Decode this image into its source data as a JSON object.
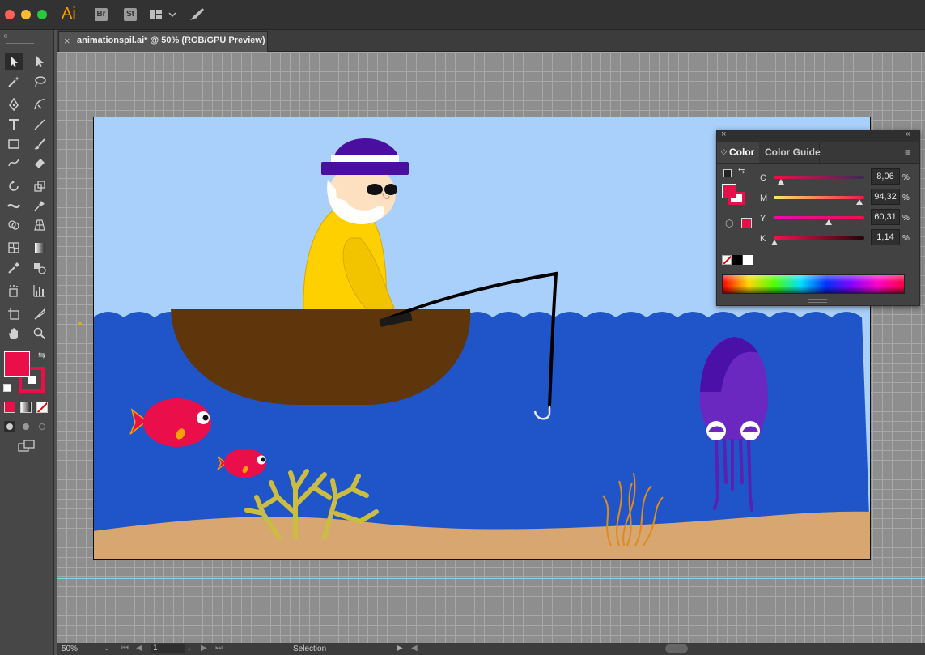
{
  "app": {
    "logo": "Ai",
    "bridge_label": "Br",
    "stock_label": "St"
  },
  "document_tab": {
    "title": "animationspil.ai* @ 50% (RGB/GPU Preview)",
    "close_glyph": "×"
  },
  "color_panel": {
    "tabs": [
      {
        "label": "Color"
      },
      {
        "label": "Color Guide"
      }
    ],
    "channels": [
      {
        "label": "C",
        "value": "8,06",
        "unit": "%",
        "level": 0.0806,
        "gradient": "linear-gradient(90deg,#f20d4a,#3b2a55)"
      },
      {
        "label": "M",
        "value": "94,32",
        "unit": "%",
        "level": 0.9432,
        "gradient": "linear-gradient(90deg,#f8e76b,#f2144f)"
      },
      {
        "label": "Y",
        "value": "60,31",
        "unit": "%",
        "level": 0.6031,
        "gradient": "linear-gradient(90deg,#e60db3,#f20d4a)"
      },
      {
        "label": "K",
        "value": "1,14",
        "unit": "%",
        "level": 0.0114,
        "gradient": "linear-gradient(90deg,#f2144f,#250508)"
      }
    ],
    "fill_color": "#ea0f4a"
  },
  "status_bar": {
    "zoom": "50%",
    "artboard": "1",
    "tool_name": "Selection"
  },
  "colors": {
    "sky": "#a9d0fa",
    "water": "#1f55c8",
    "sand": "#d7a671",
    "boat": "#5f360b",
    "raincoat": "#fed000",
    "hat": "#4a0fa0",
    "fish": "#ea0f4a",
    "squid": "#6a28c1",
    "coral": "#cbbd42",
    "seaweed": "#e08a1a"
  }
}
